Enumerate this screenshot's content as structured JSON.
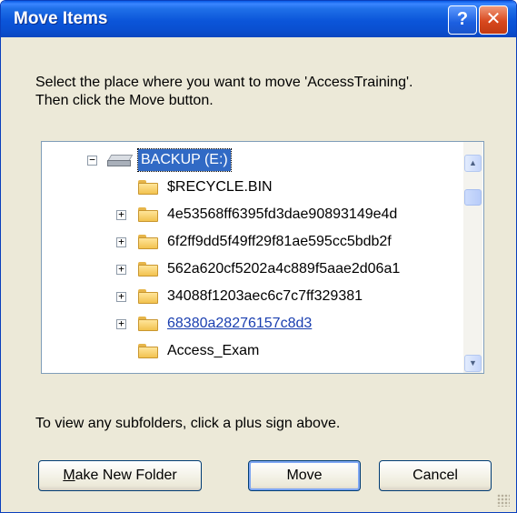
{
  "window": {
    "title": "Move Items"
  },
  "titlebar": {
    "help_label": "?",
    "close_label": "✕"
  },
  "instructions": {
    "line1": "Select the place where you want to move 'AccessTraining'.",
    "line2": "Then click the Move button."
  },
  "tree": {
    "root": {
      "label": "BACKUP (E:)",
      "icon": "drive-icon",
      "expander": "−",
      "selected": true
    },
    "items": [
      {
        "label": "$RECYCLE.BIN",
        "icon": "folder-icon",
        "expander": ""
      },
      {
        "label": "4e53568ff6395fd3dae90893149e4d",
        "icon": "folder-icon",
        "expander": "+"
      },
      {
        "label": "6f2ff9dd5f49ff29f81ae595cc5bdb2f",
        "icon": "folder-icon",
        "expander": "+"
      },
      {
        "label": "562a620cf5202a4c889f5aae2d06a1",
        "icon": "folder-icon",
        "expander": "+"
      },
      {
        "label": "34088f1203aec6c7c7ff329381",
        "icon": "folder-icon",
        "expander": "+"
      },
      {
        "label": "68380a28276157c8d3",
        "icon": "folder-icon",
        "expander": "+",
        "hovered": true
      },
      {
        "label": "Access_Exam",
        "icon": "folder-icon",
        "expander": ""
      }
    ]
  },
  "scrollbar": {
    "up_glyph": "▲",
    "down_glyph": "▼"
  },
  "hint": "To view any subfolders, click a plus sign above.",
  "buttons": {
    "new_folder": {
      "mnemonic": "M",
      "rest": "ake New Folder"
    },
    "move": "Move",
    "cancel": "Cancel"
  },
  "colors": {
    "titlebar": "#0b55d9",
    "selection": "#316ac5",
    "dialog_face": "#ece9d8"
  }
}
